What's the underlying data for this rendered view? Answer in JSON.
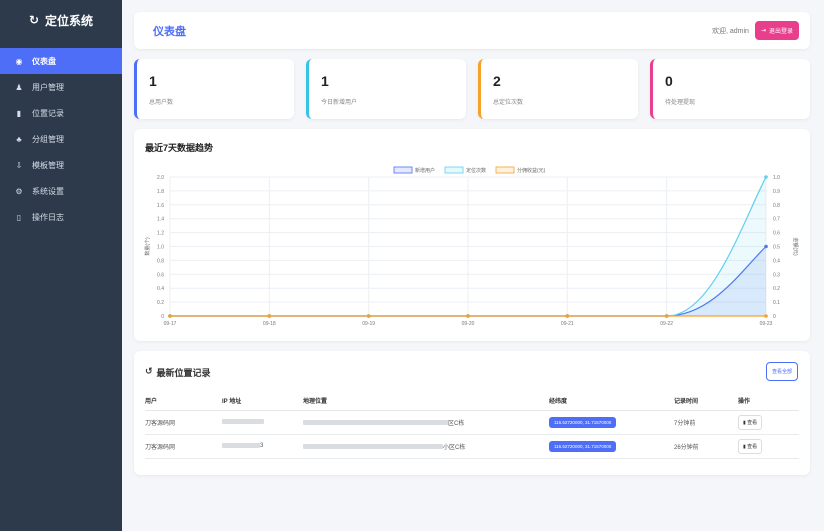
{
  "app": {
    "brand": "定位系统",
    "brand_icon": "location-icon"
  },
  "sidebar": {
    "items": [
      {
        "label": "仪表盘",
        "icon": "dashboard-icon",
        "active": true
      },
      {
        "label": "用户管理",
        "icon": "users-icon",
        "active": false
      },
      {
        "label": "位置记录",
        "icon": "map-icon",
        "active": false
      },
      {
        "label": "分组管理",
        "icon": "sitemap-icon",
        "active": false
      },
      {
        "label": "模板管理",
        "icon": "download-icon",
        "active": false
      },
      {
        "label": "系统设置",
        "icon": "cogs-icon",
        "active": false
      },
      {
        "label": "操作日志",
        "icon": "clipboard-icon",
        "active": false
      }
    ]
  },
  "header": {
    "title": "仪表盘",
    "welcome": "欢迎, admin",
    "logout": "退出登录"
  },
  "stats": [
    {
      "value": "1",
      "label": "总用户数",
      "color": "#4f6ef7"
    },
    {
      "value": "1",
      "label": "今日新增用户",
      "color": "#36c3e8"
    },
    {
      "value": "2",
      "label": "总定位次数",
      "color": "#f6a22a"
    },
    {
      "value": "0",
      "label": "待处理提现",
      "color": "#e83e8c"
    }
  ],
  "chart": {
    "title": "最近7天数据趋势"
  },
  "chart_data": {
    "type": "line",
    "title": "最近7天数据趋势",
    "x": [
      "09-17",
      "09-18",
      "09-19",
      "09-20",
      "09-21",
      "09-22",
      "09-23"
    ],
    "series": [
      {
        "name": "新增用户",
        "values": [
          0,
          0,
          0,
          0,
          0,
          0,
          1
        ],
        "axis": "left",
        "color": "#4f6ef7"
      },
      {
        "name": "定位次数",
        "values": [
          0,
          0,
          0,
          0,
          0,
          0,
          2
        ],
        "axis": "left",
        "color": "#5fd0ef"
      },
      {
        "name": "分佣收益(元)",
        "values": [
          0,
          0,
          0,
          0,
          0,
          0,
          0
        ],
        "axis": "right",
        "color": "#f6a22a"
      }
    ],
    "ylabel_left": "数量(个)",
    "ylabel_right": "金额(元)",
    "yticks_left": [
      "2.0",
      "1.8",
      "1.6",
      "1.4",
      "1.2",
      "1.0",
      "0.8",
      "0.6",
      "0.4",
      "0.2",
      "0"
    ],
    "yticks_right": [
      "1.0",
      "0.9",
      "0.8",
      "0.7",
      "0.6",
      "0.5",
      "0.4",
      "0.3",
      "0.2",
      "0.1",
      "0"
    ],
    "ylim_left": [
      0,
      2
    ],
    "ylim_right": [
      0,
      1
    ],
    "legend": "top-center"
  },
  "records": {
    "title": "最新位置记录",
    "view_all": "查看全部",
    "columns": [
      "用户",
      "IP 地址",
      "地理位置",
      "经纬度",
      "记录时间",
      "操作"
    ],
    "rows": [
      {
        "user": "刀客源码网",
        "ip_end": "",
        "location_end": "区C栋",
        "coords": "116.52720000, 31.71570000",
        "time": "7分钟前",
        "action": "查看"
      },
      {
        "user": "刀客源码网",
        "ip_end": "3",
        "location_end": "小区C栋",
        "coords": "116.52720000, 31.71570000",
        "time": "26分钟前",
        "action": "查看"
      }
    ]
  }
}
